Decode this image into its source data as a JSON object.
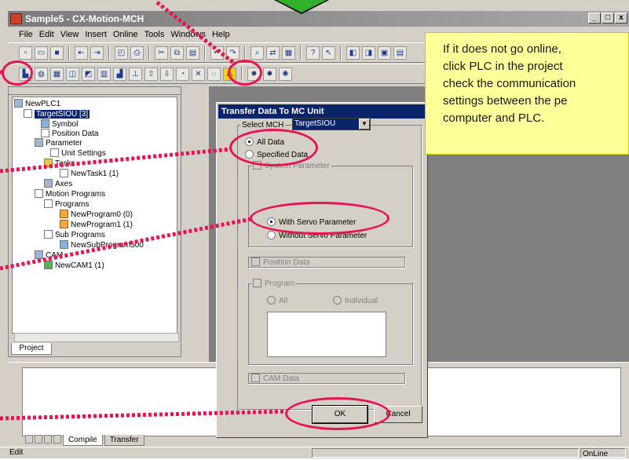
{
  "window": {
    "title": "Sample5 - CX-Motion-MCH",
    "minimize": "_",
    "maximize": "□",
    "close": "x"
  },
  "menu": [
    "File",
    "Edit",
    "View",
    "Insert",
    "Online",
    "Tools",
    "Windows",
    "Help"
  ],
  "project_tree": {
    "root": "NewPLC1",
    "unit": "TargetSIOU [3]",
    "symbol": "Symbol",
    "position_data": "Position Data",
    "parameter": "Parameter",
    "unit_settings": "Unit Settings",
    "tasks": "Tasks",
    "new_task": "NewTask1 (1)",
    "axes": "Axes",
    "motion_programs": "Motion Programs",
    "programs": "Programs",
    "program0": "NewProgram0 (0)",
    "program1": "NewProgram1 (1)",
    "sub_programs": "Sub Programs",
    "sub_program": "NewSubProgram500",
    "cam": "CAM",
    "cam1": "NewCAM1 (1)"
  },
  "project_tab": "Project",
  "output_tabs": [
    "Compile",
    "Transfer"
  ],
  "status": {
    "left": "Edit",
    "mode": "OnLine"
  },
  "dialog": {
    "title": "Transfer Data To MC Unit",
    "select_mch_label": "Select MCH",
    "select_mch_value": "TargetSIOU",
    "all_data": "All Data",
    "specified_data": "Specified Data",
    "system_parameter": "System Parameter",
    "with_servo": "With Servo Parameter",
    "without_servo": "Without Servo Parameter",
    "position_data": "Position Data",
    "program": "Program",
    "all": "All",
    "individual": "Individual",
    "cam_data": "CAM Data",
    "ok": "OK",
    "cancel": "Cancel"
  },
  "callout": {
    "lines": [
      "If it does not go online,",
      "click PLC in the project",
      "check the communication",
      "settings between the pe",
      "computer and PLC."
    ]
  },
  "colors": {
    "highlight": "#e8134f",
    "callout_bg": "#ffff99",
    "arrow": "#33b02b",
    "title_active": "#0a246a"
  }
}
